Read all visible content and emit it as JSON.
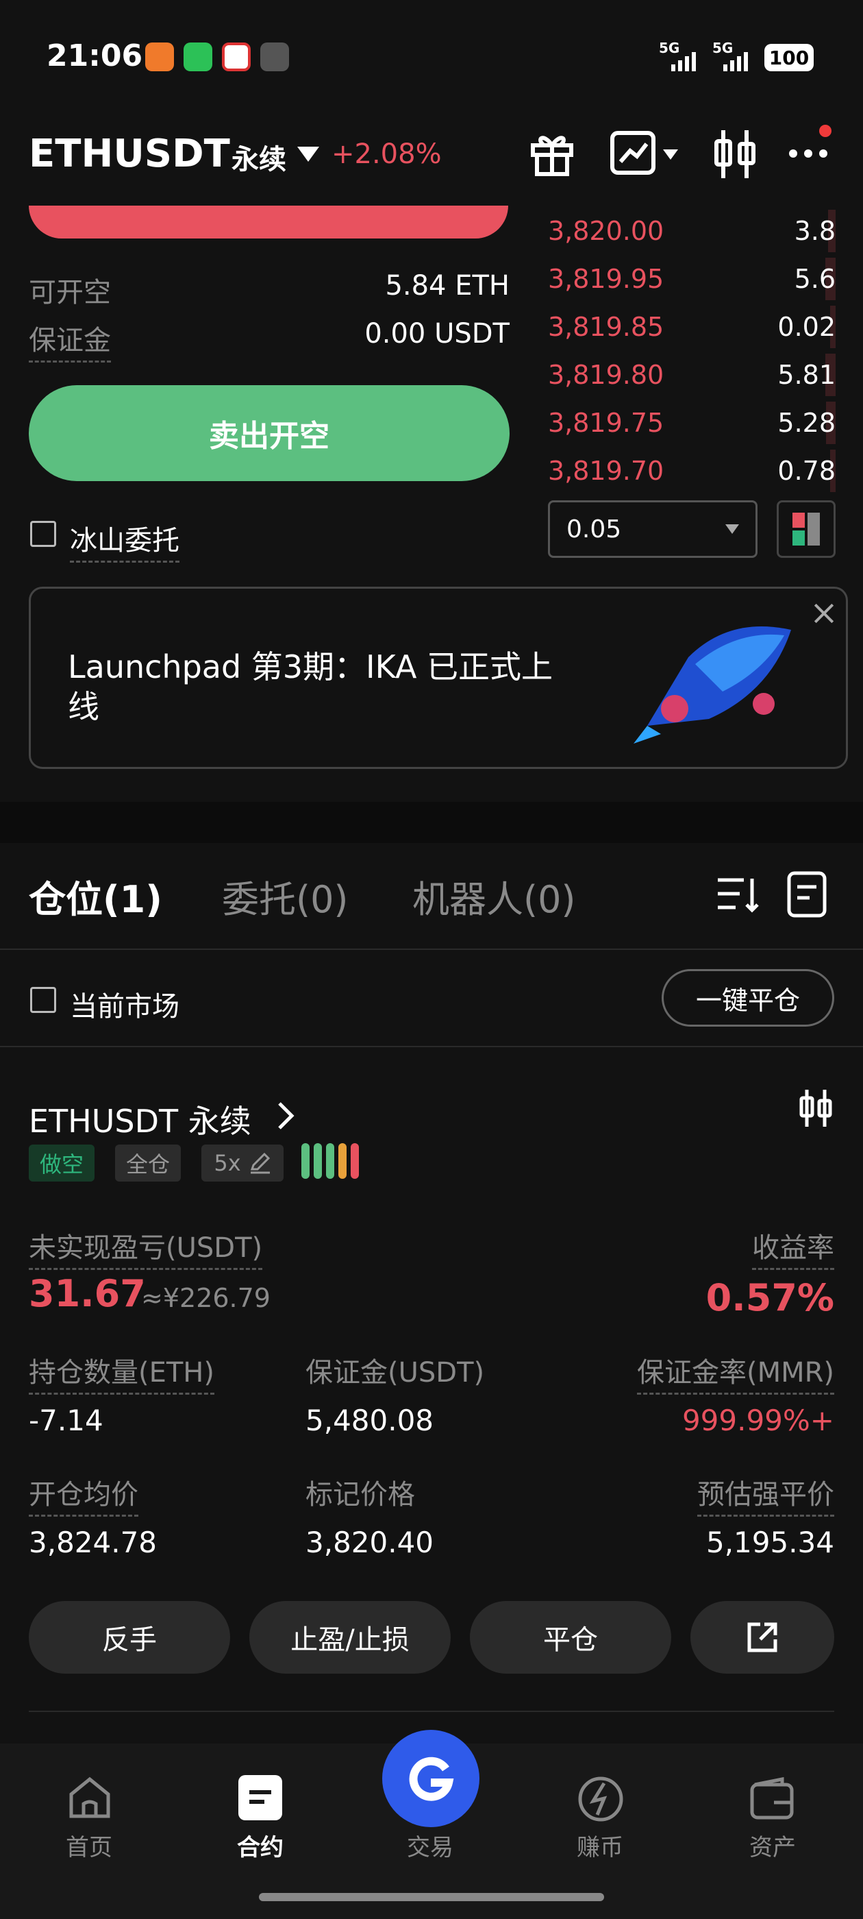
{
  "status_bar": {
    "time": "21:06",
    "battery": "100",
    "net1": "5G",
    "net2": "5G",
    "app_icons": [
      "cashback-app-icon",
      "wechat-icon",
      "bank-app-icon",
      "capcut-icon"
    ]
  },
  "header": {
    "symbol": "ETHUSDT",
    "contract_type": "永续",
    "change": "+2.08%",
    "icons": [
      "gift-icon",
      "chart-icon",
      "candlestick-icon",
      "more-icon"
    ]
  },
  "trade_panel": {
    "available_short_label": "可开空",
    "available_short_value": "5.84 ETH",
    "margin_label": "保证金",
    "margin_value": "0.00 USDT",
    "sell_button": "卖出开空",
    "iceberg_label": "冰山委托"
  },
  "orderbook": {
    "rows": [
      {
        "price": "3,820.00",
        "qty": "3.8",
        "depth": 0.25
      },
      {
        "price": "3,819.95",
        "qty": "5.6",
        "depth": 0.35
      },
      {
        "price": "3,819.85",
        "qty": "0.02",
        "depth": 0.05
      },
      {
        "price": "3,819.80",
        "qty": "5.81",
        "depth": 0.36
      },
      {
        "price": "3,819.75",
        "qty": "5.28",
        "depth": 0.33
      },
      {
        "price": "3,819.70",
        "qty": "0.78",
        "depth": 0.1
      }
    ],
    "precision": "0.05"
  },
  "banner": {
    "text": "Launchpad 第3期：IKA 已正式上线",
    "text_line1": "Launchpad 第3期：IKA 已正式上",
    "text_line2": "线"
  },
  "tabs": {
    "positions": "仓位(1)",
    "orders": "委托(0)",
    "bots": "机器人(0)"
  },
  "filter": {
    "current_market": "当前市场",
    "close_all": "一键平仓"
  },
  "position": {
    "title": "ETHUSDT 永续",
    "side": "做空",
    "margin_mode": "全仓",
    "leverage": "5x",
    "unrealized_label": "未实现盈亏(USDT)",
    "unrealized_value": "31.67",
    "unrealized_cny": "≈¥226.79",
    "roe_label": "收益率",
    "roe_value": "0.57%",
    "size_label": "持仓数量(ETH)",
    "size_value": "-7.14",
    "margin_label": "保证金(USDT)",
    "margin_value": "5,480.08",
    "mmr_label": "保证金率(MMR)",
    "mmr_value": "999.99%+",
    "entry_label": "开仓均价",
    "entry_value": "3,824.78",
    "mark_label": "标记价格",
    "mark_value": "3,820.40",
    "liq_label": "预估强平价",
    "liq_value": "5,195.34",
    "btn_reverse": "反手",
    "btn_tpsl": "止盈/止损",
    "btn_close": "平仓"
  },
  "bottom_nav": {
    "home": "首页",
    "futures": "合约",
    "trade": "交易",
    "earn": "赚币",
    "assets": "资产"
  },
  "colors": {
    "red": "#e8525f",
    "green": "#5cbf80",
    "accent_blue": "#2f5bea",
    "background": "#121212"
  }
}
